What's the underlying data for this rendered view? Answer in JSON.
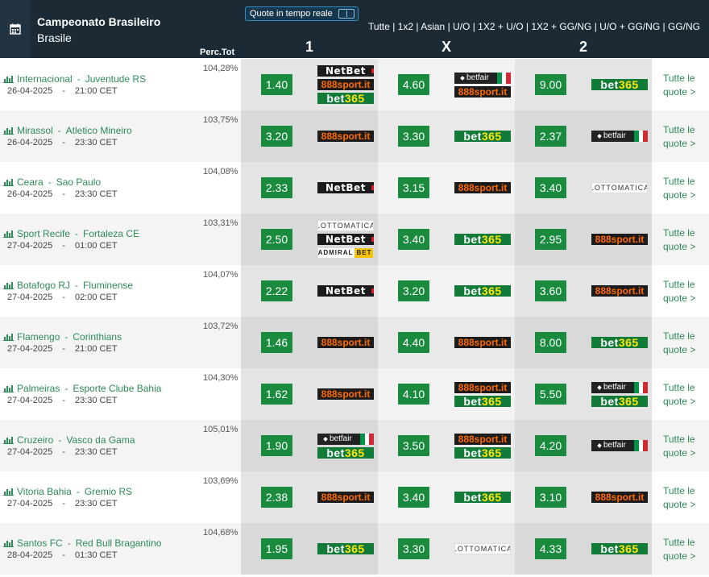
{
  "header": {
    "competition": "Campeonato Brasileiro",
    "country": "Brasile",
    "live_label": "Quote in tempo reale",
    "markets": [
      "Tutte",
      "1x2",
      "Asian",
      "U/O",
      "1X2 + U/O",
      "1X2 + GG/NG",
      "U/O + GG/NG",
      "GG/NG"
    ],
    "perc_label": "Perc.Tot",
    "col_1": "1",
    "col_x": "X",
    "col_2": "2"
  },
  "all_quotes_label": "Tutte le quote >",
  "matches": [
    {
      "home": "Internacional",
      "away": "Juventude RS",
      "date": "26-04-2025",
      "time": "21:00 CET",
      "perc": "104,28%",
      "o1": "1.40",
      "b1": [
        "netbet",
        "888sport",
        "bet365"
      ],
      "ox": "4.60",
      "bx": [
        "betfair",
        "888sport"
      ],
      "o2": "9.00",
      "b2": [
        "bet365"
      ]
    },
    {
      "home": "Mirassol",
      "away": "Atletico Mineiro",
      "date": "26-04-2025",
      "time": "23:30 CET",
      "perc": "103,75%",
      "o1": "3.20",
      "b1": [
        "888sport"
      ],
      "ox": "3.30",
      "bx": [
        "bet365"
      ],
      "o2": "2.37",
      "b2": [
        "betfair"
      ]
    },
    {
      "home": "Ceara",
      "away": "Sao Paulo",
      "date": "26-04-2025",
      "time": "23:30 CET",
      "perc": "104,08%",
      "o1": "2.33",
      "b1": [
        "netbet"
      ],
      "ox": "3.15",
      "bx": [
        "888sport"
      ],
      "o2": "3.40",
      "b2": [
        "lottomatica"
      ]
    },
    {
      "home": "Sport Recife",
      "away": "Fortaleza CE",
      "date": "27-04-2025",
      "time": "01:00 CET",
      "perc": "103,31%",
      "o1": "2.50",
      "b1": [
        "lottomatica",
        "netbet",
        "admiral"
      ],
      "ox": "3.40",
      "bx": [
        "bet365"
      ],
      "o2": "2.95",
      "b2": [
        "888sport"
      ]
    },
    {
      "home": "Botafogo RJ",
      "away": "Fluminense",
      "date": "27-04-2025",
      "time": "02:00 CET",
      "perc": "104,07%",
      "o1": "2.22",
      "b1": [
        "netbet"
      ],
      "ox": "3.20",
      "bx": [
        "bet365"
      ],
      "o2": "3.60",
      "b2": [
        "888sport"
      ]
    },
    {
      "home": "Flamengo",
      "away": "Corinthians",
      "date": "27-04-2025",
      "time": "21:00 CET",
      "perc": "103,72%",
      "o1": "1.46",
      "b1": [
        "888sport"
      ],
      "ox": "4.40",
      "bx": [
        "888sport"
      ],
      "o2": "8.00",
      "b2": [
        "bet365"
      ]
    },
    {
      "home": "Palmeiras",
      "away": "Esporte Clube Bahia",
      "date": "27-04-2025",
      "time": "23:30 CET",
      "perc": "104,30%",
      "o1": "1.62",
      "b1": [
        "888sport"
      ],
      "ox": "4.10",
      "bx": [
        "888sport",
        "bet365"
      ],
      "o2": "5.50",
      "b2": [
        "betfair",
        "bet365"
      ]
    },
    {
      "home": "Cruzeiro",
      "away": "Vasco da Gama",
      "date": "27-04-2025",
      "time": "23:30 CET",
      "perc": "105,01%",
      "o1": "1.90",
      "b1": [
        "betfair",
        "bet365"
      ],
      "ox": "3.50",
      "bx": [
        "888sport",
        "bet365"
      ],
      "o2": "4.20",
      "b2": [
        "betfair"
      ]
    },
    {
      "home": "Vitoria Bahia",
      "away": "Gremio RS",
      "date": "27-04-2025",
      "time": "23:30 CET",
      "perc": "103,69%",
      "o1": "2.38",
      "b1": [
        "888sport"
      ],
      "ox": "3.40",
      "bx": [
        "bet365"
      ],
      "o2": "3.10",
      "b2": [
        "888sport"
      ]
    },
    {
      "home": "Santos FC",
      "away": "Red Bull Bragantino",
      "date": "28-04-2025",
      "time": "01:30 CET",
      "perc": "104,68%",
      "o1": "1.95",
      "b1": [
        "bet365"
      ],
      "ox": "3.30",
      "bx": [
        "lottomatica"
      ],
      "o2": "4.33",
      "b2": [
        "bet365"
      ]
    }
  ],
  "bookmaker_logos": {
    "netbet": "NetBet",
    "888sport": "888sport.it",
    "bet365": "bet365",
    "betfair": "betfair",
    "lottomatica": "LOTTOMATICA",
    "admiral": "ADMIRALBET"
  },
  "colors": {
    "header_bg": "#1b2a35",
    "odd_bg": "#1a8a3f",
    "link": "#2e8b57"
  }
}
